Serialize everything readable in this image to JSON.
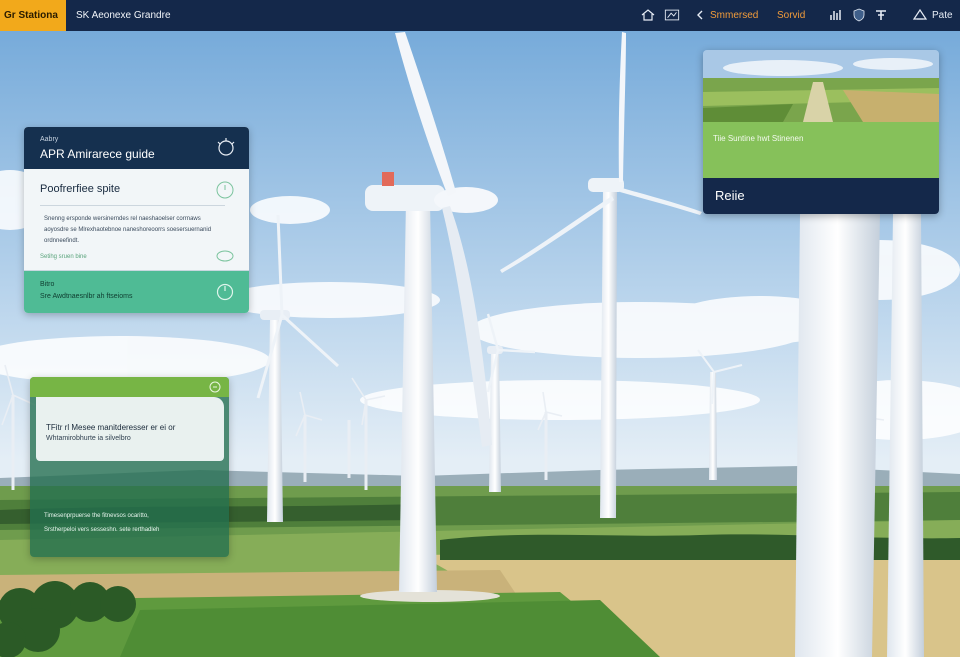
{
  "topbar": {
    "brand": "Gr Stationa",
    "title": "SK Aeonexe Grandre",
    "nav_link_1": "Smmersed",
    "nav_link_2": "Sorvid",
    "user_label": "Pate"
  },
  "guide_card": {
    "kicker": "Aabry",
    "heading": "APR Amirarece guide",
    "subheading": "Poofrerfiee spite",
    "body_text": "Snenng ersponde wersinerndes rel naeshaoelser corrnaws aoyosdre se Mlrexhaotebnoe naneshoreoorrs soesersuernanid ordnneefindt.",
    "meta": "Setihg sruen bine",
    "footer_title": "Bitro",
    "footer_text": "Sre Awdtnaesnlbr ah ftseioms"
  },
  "notice_card": {
    "line_1": "TFitr rl Mesee manitderesser er ei or",
    "line_2": "Whtamirobhurte ia silvelbro",
    "body_1": "Timesenprpuerse the fitnevsos ocaritto,",
    "body_2": "Srstherpeloi vers sesseshn. sete rerthadleh"
  },
  "resume_card": {
    "caption": "Tiie Suntine hwt Stinenen",
    "button_label": "Reiie"
  },
  "colors": {
    "topbar_bg": "#14284a",
    "brand_bg": "#f2a91b",
    "accent_green": "#86c15a",
    "teal": "#4fbb95",
    "link_orange": "#f29c3a"
  },
  "icons": {
    "home": "home-icon",
    "chart": "chart-icon",
    "back": "chevron-left-icon",
    "stats": "bar-chart-icon",
    "shield": "shield-icon",
    "tools": "tools-icon",
    "user": "user-icon"
  }
}
